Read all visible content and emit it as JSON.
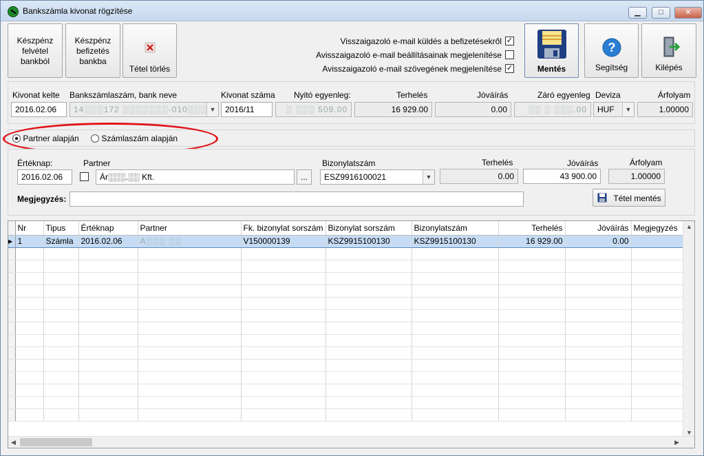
{
  "window": {
    "title": "Bankszámla kivonat rögzítése",
    "minimize": "▁",
    "maximize": "□",
    "close": "✕"
  },
  "toolbar": {
    "cash_withdraw": [
      "Készpénz",
      "felvétel",
      "bankból"
    ],
    "cash_deposit": [
      "Készpénz",
      "befizetés",
      "bankba"
    ],
    "delete_item": "Tétel törlés",
    "save": "Mentés",
    "help": "Segítség",
    "exit": "Kilépés",
    "options": [
      {
        "label": "Visszaigazoló e-mail küldés a befizetésekről",
        "checked": true
      },
      {
        "label": "Avisszaigazoló e-mail beállításainak megjelenítése",
        "checked": false
      },
      {
        "label": "Avisszaigazoló e-mail szövegének megjelenítése",
        "checked": true
      }
    ],
    "check_mark": "✓"
  },
  "header": {
    "labels": {
      "date": "Kivonat kelte",
      "account": "Bankszámlaszám, bank neve",
      "number": "Kivonat száma",
      "opening": "Nyitó egyenleg:",
      "debit": "Terhelés",
      "credit": "Jóváírás",
      "closing": "Záró egyenleg",
      "currency": "Deviza",
      "rate": "Árfolyam"
    },
    "values": {
      "date": "2016.02.06",
      "account": "14░░░172 ░░░░░░░-010░░░ ░░",
      "number": "2016/11",
      "opening": "░ ░░░ 509.00",
      "debit": "16 929.00",
      "credit": "0.00",
      "closing": "░░ ░ ░░░.00",
      "currency": "HUF",
      "rate": "1.00000"
    }
  },
  "mode": {
    "partner": "Partner alapján",
    "invoice": "Számlaszám alapján",
    "selected": "partner"
  },
  "entry": {
    "labels": {
      "value_date": "Értéknap:",
      "partner": "Partner",
      "doc_number": "Bizonylatszám",
      "debit": "Terhelés",
      "credit": "Jóváírás",
      "rate": "Árfolyam",
      "note": "Megjegyzés:"
    },
    "values": {
      "value_date": "2016.02.06",
      "partner": "Ár░░░.░░ Kft.",
      "browse": "...",
      "doc_number": "ESZ9916100021",
      "debit": "0.00",
      "credit": "43 900.00",
      "rate": "1.00000",
      "note": ""
    },
    "save_item": "Tétel mentés"
  },
  "grid": {
    "columns": [
      "Nr",
      "Tipus",
      "Értéknap",
      "Partner",
      "Fk. bizonylat sorszám",
      "Bizonylat sorszám",
      "Bizonylatszám",
      "Terhelés",
      "Jóváírás",
      "Megjegyzés"
    ],
    "rows": [
      {
        "nr": "1",
        "type": "Számla",
        "date": "2016.02.06",
        "partner": "A░░░ ░░",
        "fk_doc": "V150000139",
        "doc_serial": "KSZ9915100130",
        "doc_number": "KSZ9915100130",
        "debit": "16 929.00",
        "credit": "0.00",
        "note": ""
      }
    ],
    "row_indicator": "▶"
  }
}
